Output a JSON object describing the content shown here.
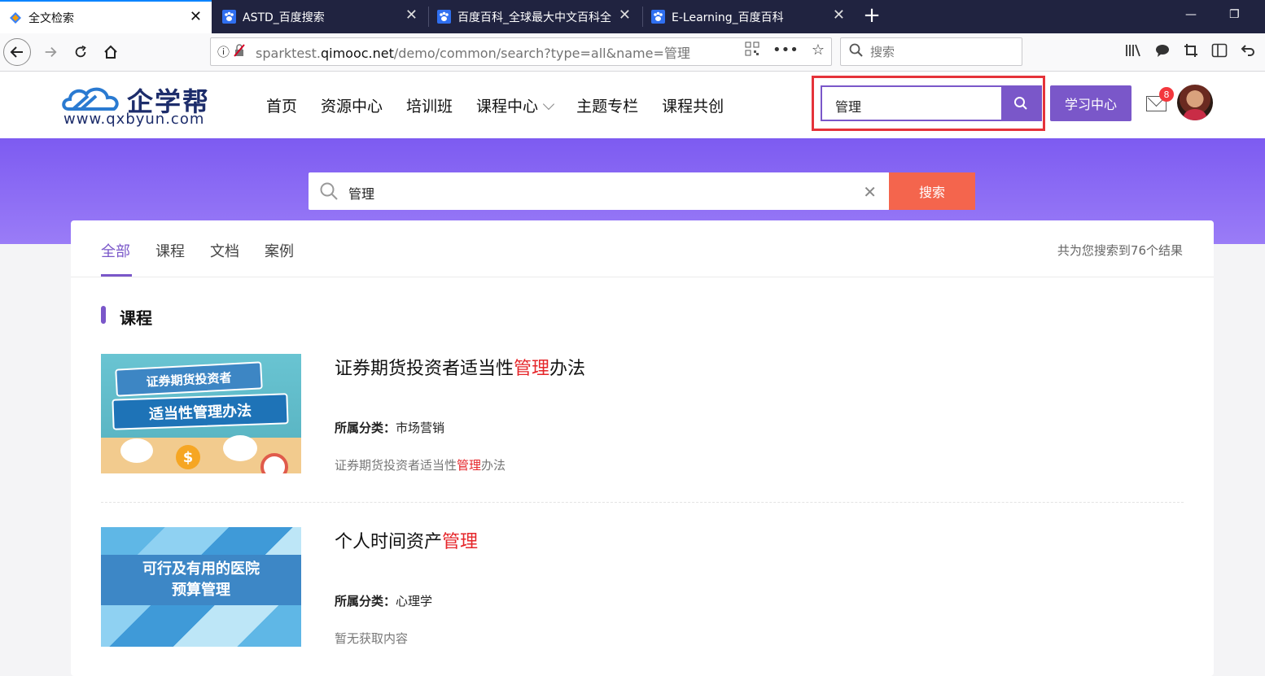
{
  "browser": {
    "tabs": [
      {
        "title": "全文检索",
        "active": true
      },
      {
        "title": "ASTD_百度搜索",
        "active": false
      },
      {
        "title": "百度百科_全球最大中文百科全",
        "active": false
      },
      {
        "title": "E-Learning_百度百科",
        "active": false
      }
    ],
    "url_prefix": "sparktest.",
    "url_domain": "qimooc.net",
    "url_path": "/demo/common/search?type=all&name=管理",
    "search_placeholder": "搜索"
  },
  "site": {
    "logo_cn": "企学帮",
    "logo_en": "www.qxbyun.com",
    "nav": [
      "首页",
      "资源中心",
      "培训班",
      "课程中心",
      "主题专栏",
      "课程共创"
    ],
    "header_search_value": "管理",
    "study_center": "学习中心",
    "mail_badge": "8"
  },
  "search": {
    "query": "管理",
    "button": "搜索"
  },
  "results": {
    "tabs": [
      "全部",
      "课程",
      "文档",
      "案例"
    ],
    "active_tab": "全部",
    "total_text": "共为您搜索到76个结果",
    "section_title": "课程",
    "items": [
      {
        "title_pre": "证券期货投资者适当性",
        "title_hl": "管理",
        "title_post": "办法",
        "category_label": "所属分类：",
        "category": "市场营销",
        "desc_pre": "证券期货投资者适当性",
        "desc_hl": "管理",
        "desc_post": "办法",
        "thumb_line1": "证券期货投资者",
        "thumb_line2": "适当性管理办法"
      },
      {
        "title_pre": "个人时间资产",
        "title_hl": "管理",
        "title_post": "",
        "category_label": "所属分类：",
        "category": "心理学",
        "desc": "暂无获取内容",
        "thumb_line1": "可行及有用的医院",
        "thumb_line2": "预算管理"
      }
    ]
  },
  "colors": {
    "brand_purple": "#7a57c9",
    "banner_purple": "#7d5bf1",
    "search_orange": "#f4654d",
    "highlight_red": "#e5262a",
    "annotation_box": "#e5333a"
  },
  "icons": [
    "tab-favicon-icon",
    "paw-icon",
    "back-icon",
    "forward-icon",
    "reload-icon",
    "home-icon",
    "info-icon",
    "insecure-icon",
    "qrcode-icon",
    "more-icon",
    "star-icon",
    "search-icon",
    "library-icon",
    "chat-icon",
    "crop-icon",
    "sidebar-icon",
    "undo-icon",
    "mail-icon",
    "clear-icon"
  ]
}
